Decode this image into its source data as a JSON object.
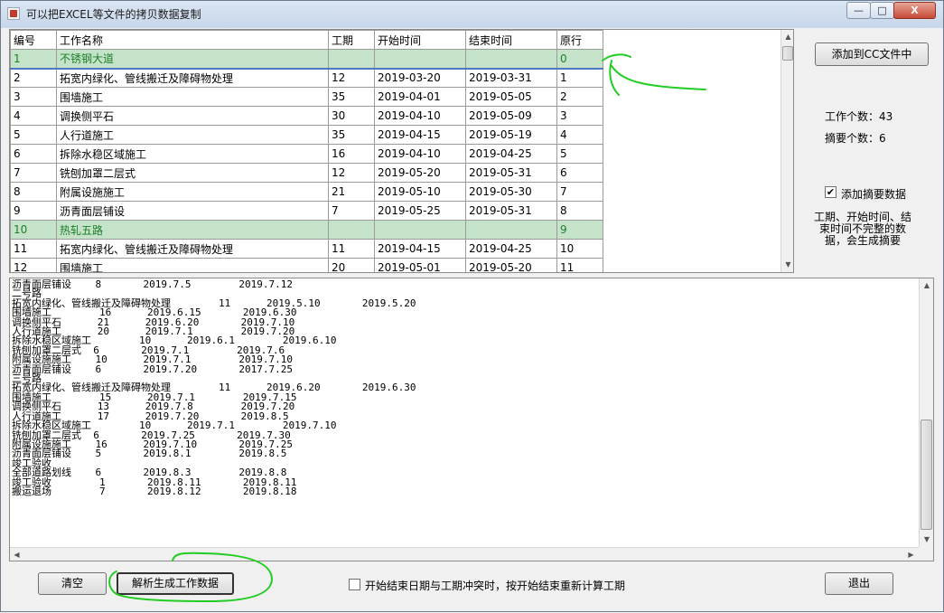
{
  "window": {
    "title": "可以把EXCEL等文件的拷贝数据复制",
    "min_label": "—",
    "max_label": "□",
    "close_label": "X"
  },
  "grid": {
    "columns": [
      "编号",
      "工作名称",
      "工期",
      "开始时间",
      "结束时间",
      "原行"
    ],
    "rows": [
      {
        "id": "1",
        "name": "不锈钢大道",
        "duration": "",
        "start": "",
        "end": "",
        "orig": "0",
        "summary": true
      },
      {
        "id": "2",
        "name": "拓宽内绿化、管线搬迁及障碍物处理",
        "duration": "12",
        "start": "2019-03-20",
        "end": "2019-03-31",
        "orig": "1",
        "summary": false
      },
      {
        "id": "3",
        "name": "围墙施工",
        "duration": "35",
        "start": "2019-04-01",
        "end": "2019-05-05",
        "orig": "2",
        "summary": false
      },
      {
        "id": "4",
        "name": "调换侧平石",
        "duration": "30",
        "start": "2019-04-10",
        "end": "2019-05-09",
        "orig": "3",
        "summary": false
      },
      {
        "id": "5",
        "name": "人行道施工",
        "duration": "35",
        "start": "2019-04-15",
        "end": "2019-05-19",
        "orig": "4",
        "summary": false
      },
      {
        "id": "6",
        "name": "拆除水稳区域施工",
        "duration": "16",
        "start": "2019-04-10",
        "end": "2019-04-25",
        "orig": "5",
        "summary": false
      },
      {
        "id": "7",
        "name": "铣刨加罩二层式",
        "duration": "12",
        "start": "2019-05-20",
        "end": "2019-05-31",
        "orig": "6",
        "summary": false
      },
      {
        "id": "8",
        "name": "附属设施施工",
        "duration": "21",
        "start": "2019-05-10",
        "end": "2019-05-30",
        "orig": "7",
        "summary": false
      },
      {
        "id": "9",
        "name": "沥青面层铺设",
        "duration": "7",
        "start": "2019-05-25",
        "end": "2019-05-31",
        "orig": "8",
        "summary": false
      },
      {
        "id": "10",
        "name": "热轧五路",
        "duration": "",
        "start": "",
        "end": "",
        "orig": "9",
        "summary": true
      },
      {
        "id": "11",
        "name": "拓宽内绿化、管线搬迁及障碍物处理",
        "duration": "11",
        "start": "2019-04-15",
        "end": "2019-04-25",
        "orig": "10",
        "summary": false
      },
      {
        "id": "12",
        "name": "围墙施工",
        "duration": "20",
        "start": "2019-05-01",
        "end": "2019-05-20",
        "orig": "11",
        "summary": false
      }
    ]
  },
  "side": {
    "add_button": "添加到CC文件中",
    "work_count": "工作个数：43",
    "summary_count": "摘要个数：6",
    "add_summary_checked": true,
    "add_summary_label": "添加摘要数据",
    "note": "工期、开始时间、结束时间不完整的数据，会生成摘要"
  },
  "text_area": {
    "lines": [
      "沥青面层铺设    8       2019.7.5        2019.7.12",
      "二号路",
      "拓宽内绿化、管线搬迁及障碍物处理        11      2019.5.10       2019.5.20",
      "围墙施工        16      2019.6.15       2019.6.30",
      "调换侧平石      21      2019.6.20       2019.7.10",
      "人行道施工      20      2019.7.1        2019.7.20",
      "拆除水稳区域施工        10      2019.6.1        2019.6.10",
      "铣刨加罩二层式  6       2019.7.1        2019.7.6",
      "附属设施施工    10      2019.7.1        2019.7.10",
      "沥青面层铺设    6       2019.7.20       2017.7.25",
      "三号路",
      "拓宽内绿化、管线搬迁及障碍物处理        11      2019.6.20       2019.6.30",
      "围墙施工        15      2019.7.1        2019.7.15",
      "调换侧平石      13      2019.7.8        2019.7.20",
      "人行道施工      17      2019.7.20       2019.8.5",
      "拆除水稳区域施工        10      2019.7.1        2019.7.10",
      "铣刨加罩二层式  6       2019.7.25       2019.7.30",
      "附属设施施工    16      2019.7.10       2019.7.25",
      "沥青面层铺设    5       2019.8.1        2019.8.5",
      "竣工验收",
      "全部道路划线    6       2019.8.3        2019.8.8",
      "竣工验收        1       2019.8.11       2019.8.11",
      "搬运退场        7       2019.8.12       2019.8.18"
    ]
  },
  "bottom": {
    "clear_button": "清空",
    "parse_button": "解析生成工作数据",
    "conflict_checked": false,
    "conflict_label": "开始结束日期与工期冲突时，按开始结束重新计算工期",
    "exit_button": "退出"
  },
  "colors": {
    "summary_row_bg": "#c5e3c9",
    "summary_row_text": "#1c7f28",
    "annotation_green": "#22cc22"
  }
}
